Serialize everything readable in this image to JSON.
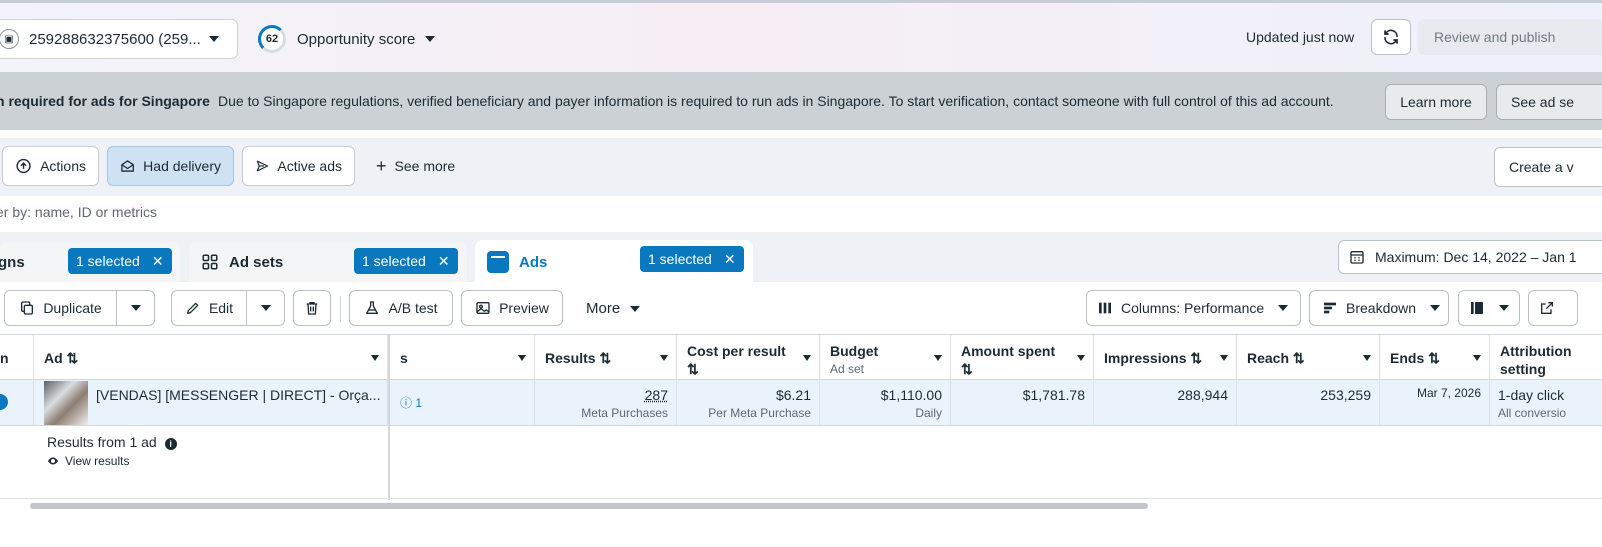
{
  "header": {
    "account": "259288632375600 (259...",
    "score_value": "62",
    "score_label": "Opportunity score",
    "updated": "Updated just now",
    "review_publish": "Review and publish"
  },
  "banner": {
    "title": "n required for ads for Singapore",
    "message": "Due to Singapore regulations, verified beneficiary and payer information is required to run ads in Singapore. To start verification, contact someone with full control of this ad account.",
    "learn_more": "Learn more",
    "see_ad_sets": "See ad se"
  },
  "filters": {
    "actions": "Actions",
    "had_delivery": "Had delivery",
    "active_ads": "Active ads",
    "see_more": "See more",
    "create_view": "Create a v"
  },
  "search": {
    "placeholder": "er by: name, ID or metrics"
  },
  "tabs": {
    "campaigns": "gns",
    "campaigns_selected": "1 selected",
    "adsets": "Ad sets",
    "adsets_selected": "1 selected",
    "ads": "Ads",
    "ads_selected": "1 selected",
    "date_range": "Maximum: Dec 14, 2022 – Jan 1"
  },
  "toolbar": {
    "duplicate": "Duplicate",
    "edit": "Edit",
    "ab_test": "A/B test",
    "preview": "Preview",
    "more": "More",
    "columns": "Columns: Performance",
    "breakdown": "Breakdown"
  },
  "table": {
    "headers": {
      "col0": "n",
      "ad": "Ad ⇅",
      "col_s": "s",
      "results": "Results ⇅",
      "cost_per_result": "Cost per result",
      "cost_sort": "⇅",
      "budget": "Budget",
      "budget_sub": "Ad set",
      "amount_spent": "Amount spent",
      "amount_sort": "⇅",
      "impressions": "Impressions ⇅",
      "reach": "Reach ⇅",
      "ends": "Ends ⇅",
      "attribution": "Attribution",
      "attribution_2": "setting"
    },
    "row": {
      "ad_name": "[VENDAS] [MESSENGER | DIRECT] - Orça...",
      "count": "1",
      "results": "287",
      "results_sub": "Meta Purchases",
      "cost": "$6.21",
      "cost_sub": "Per Meta Purchase",
      "budget": "$1,110.00",
      "budget_sub": "Daily",
      "amount_spent": "$1,781.78",
      "impressions": "288,944",
      "reach": "253,259",
      "ends": "Mar 7, 2026",
      "attribution": "1-day click",
      "attribution_sub": "All conversio"
    },
    "summary": "Results from 1 ad",
    "view_results": "View results"
  }
}
